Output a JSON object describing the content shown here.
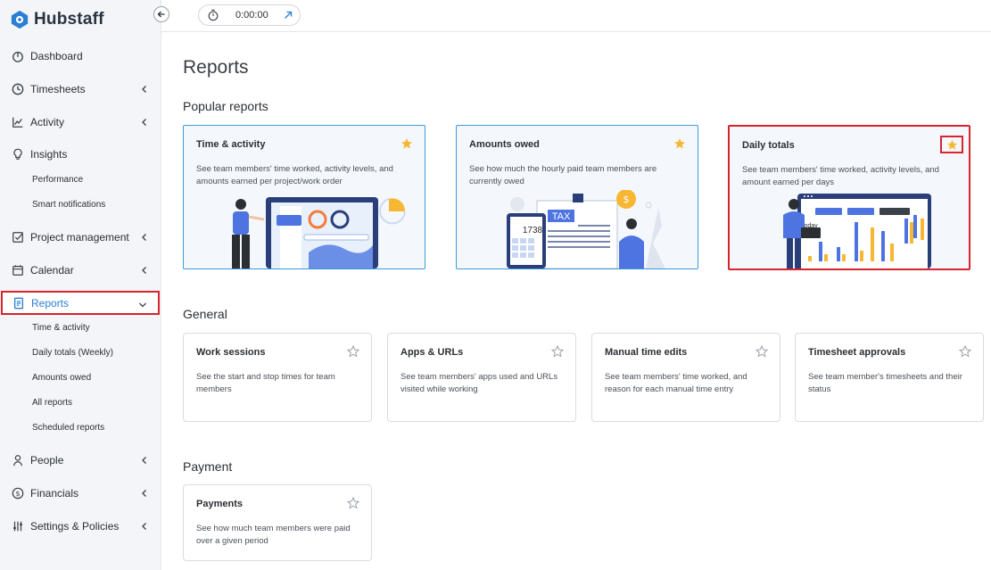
{
  "app": {
    "name": "Hubstaff"
  },
  "timer": {
    "value": "0:00:00"
  },
  "sidebar": {
    "items": [
      {
        "label": "Dashboard",
        "icon": "dashboard-icon"
      },
      {
        "label": "Timesheets",
        "icon": "clock-icon"
      },
      {
        "label": "Activity",
        "icon": "activity-chart-icon"
      },
      {
        "label": "Insights",
        "icon": "lightbulb-icon"
      },
      {
        "label": "Performance"
      },
      {
        "label": "Smart notifications"
      },
      {
        "label": "Project management",
        "icon": "checkbox-icon"
      },
      {
        "label": "Calendar",
        "icon": "calendar-icon"
      },
      {
        "label": "Reports",
        "icon": "report-icon"
      },
      {
        "label": "Time & activity"
      },
      {
        "label": "Daily totals (Weekly)"
      },
      {
        "label": "Amounts owed"
      },
      {
        "label": "All reports"
      },
      {
        "label": "Scheduled reports"
      },
      {
        "label": "People",
        "icon": "person-icon"
      },
      {
        "label": "Financials",
        "icon": "dollar-circle-icon"
      },
      {
        "label": "Settings & Policies",
        "icon": "sliders-icon"
      }
    ]
  },
  "page": {
    "title": "Reports",
    "popular_title": "Popular reports",
    "general_title": "General",
    "payment_title": "Payment"
  },
  "popular": [
    {
      "title": "Time & activity",
      "desc": "See team members' time worked, activity levels, and amounts earned per project/work order",
      "starred": true
    },
    {
      "title": "Amounts owed",
      "desc": "See how much the hourly paid team members are currently owed",
      "starred": true
    },
    {
      "title": "Daily totals",
      "desc": "See team members' time worked, activity levels, and amount earned per days",
      "starred": true
    }
  ],
  "general": [
    {
      "title": "Work sessions",
      "desc": "See the start and stop times for team members"
    },
    {
      "title": "Apps & URLs",
      "desc": "See team members' apps used and URLs visited while working"
    },
    {
      "title": "Manual time edits",
      "desc": "See team members' time worked, and reason for each manual time entry"
    },
    {
      "title": "Timesheet approvals",
      "desc": "See team member's timesheets and their status"
    }
  ],
  "payment": [
    {
      "title": "Payments",
      "desc": "See how much team members were paid over a given period"
    }
  ],
  "illustrations": {
    "amounts_owed_calc": "1738",
    "amounts_owed_tax": "TAX",
    "daily_totals_today": "Today"
  },
  "colors": {
    "accent": "#2a7fd4",
    "star": "#f7b733",
    "highlight": "#d9232e",
    "popular_border": "#3a9bd8"
  }
}
